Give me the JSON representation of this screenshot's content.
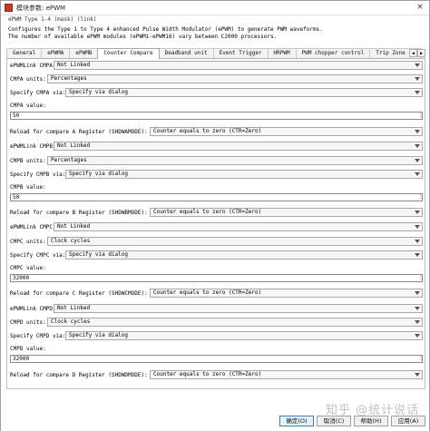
{
  "window": {
    "title": "模块参数: ePWM",
    "close": "×"
  },
  "description": {
    "header": "ePWM Type 1-4 (mask) (link)",
    "line1": "Configures the Type 1 to Type 4 enhanced Pulse Width Modulator (ePWM) to generate PWM waveforms.",
    "line2": "The number of available ePWM modules (ePWM1-ePWM16) vary between C2000 processors."
  },
  "tabs": [
    "General",
    "ePWMA",
    "ePWMB",
    "Counter Compare",
    "Deadband unit",
    "Event Trigger",
    "HRPWM",
    "PWM chopper control",
    "Trip Zone un"
  ],
  "active_tab": "Counter Compare",
  "tab_scroll": {
    "left": "◀",
    "right": "▶"
  },
  "fields": {
    "cmpa_link_label": "ePWMLink CMPA",
    "cmpa_link_value": "Not Linked",
    "cmpa_units_label": "CMPA units:",
    "cmpa_units_value": "Percentages",
    "cmpa_spec_label": "Specify CMPA via:",
    "cmpa_spec_value": "Specify via dialog",
    "cmpa_value_label": "CMPA value:",
    "cmpa_value": "50",
    "reload_a_label": "Reload for compare A Register (SHDWAMODE):",
    "reload_a_value": "Counter equals to zero (CTR=Zero)",
    "cmpb_link_label": "ePWMLink CMPB",
    "cmpb_link_value": "Not Linked",
    "cmpb_units_label": "CMPB units:",
    "cmpb_units_value": "Percentages",
    "cmpb_spec_label": "Specify CMPB via:",
    "cmpb_spec_value": "Specify via dialog",
    "cmpb_value_label": "CMPB value:",
    "cmpb_value": "50",
    "reload_b_label": "Reload for compare B Register (SHDWBMODE):",
    "reload_b_value": "Counter equals to zero (CTR=Zero)",
    "cmpc_link_label": "ePWMLink CMPC",
    "cmpc_link_value": "Not Linked",
    "cmpc_units_label": "CMPC units:",
    "cmpc_units_value": "Clock cycles",
    "cmpc_spec_label": "Specify CMPC via:",
    "cmpc_spec_value": "Specify via dialog",
    "cmpc_value_label": "CMPC value:",
    "cmpc_value": "32000",
    "reload_c_label": "Reload for compare C Register (SHDWCMODE):",
    "reload_c_value": "Counter equals to zero (CTR=Zero)",
    "cmpd_link_label": "ePWMLink CMPD",
    "cmpd_link_value": "Not Linked",
    "cmpd_units_label": "CMPD units:",
    "cmpd_units_value": "Clock cycles",
    "cmpd_spec_label": "Specify CMPD via:",
    "cmpd_spec_value": "Specify via dialog",
    "cmpd_value_label": "CMPD value:",
    "cmpd_value": "32000",
    "reload_d_label": "Reload for compare D Register (SHDWDMODE):",
    "reload_d_value": "Counter equals to zero (CTR=Zero)",
    "ellipsis": "⋮"
  },
  "buttons": {
    "ok": "确定(O)",
    "cancel": "取消(C)",
    "help": "帮助(H)",
    "apply": "应用(A)"
  },
  "watermark": "知乎 @统计说话"
}
